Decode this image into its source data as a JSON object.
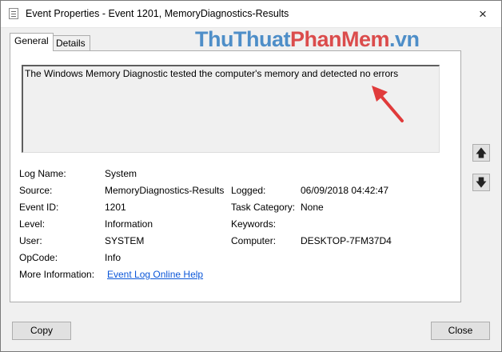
{
  "window": {
    "title": "Event Properties - Event 1201, MemoryDiagnostics-Results"
  },
  "tabs": [
    "General",
    "Details"
  ],
  "watermark": {
    "part1": "ThuThuat",
    "part2": "PhanMem",
    "part3": ".vn"
  },
  "message": "The Windows Memory Diagnostic tested the computer's memory and detected no errors",
  "fields": {
    "log_name_label": "Log Name:",
    "log_name": "System",
    "source_label": "Source:",
    "source": "MemoryDiagnostics-Results",
    "logged_label": "Logged:",
    "logged": "06/09/2018 04:42:47",
    "event_id_label": "Event ID:",
    "event_id": "1201",
    "task_category_label": "Task Category:",
    "task_category": "None",
    "level_label": "Level:",
    "level": "Information",
    "keywords_label": "Keywords:",
    "keywords": "",
    "user_label": "User:",
    "user": "SYSTEM",
    "computer_label": "Computer:",
    "computer": "DESKTOP-7FM37D4",
    "opcode_label": "OpCode:",
    "opcode": "Info",
    "more_info_label": "More Information:",
    "more_info_link": "Event Log Online Help"
  },
  "buttons": {
    "copy": "Copy",
    "close": "Close"
  },
  "icons": {
    "close": "×",
    "up": "🡅",
    "down": "🡇"
  },
  "colors": {
    "link": "#0b56d8",
    "arrow": "#e03b3b"
  }
}
